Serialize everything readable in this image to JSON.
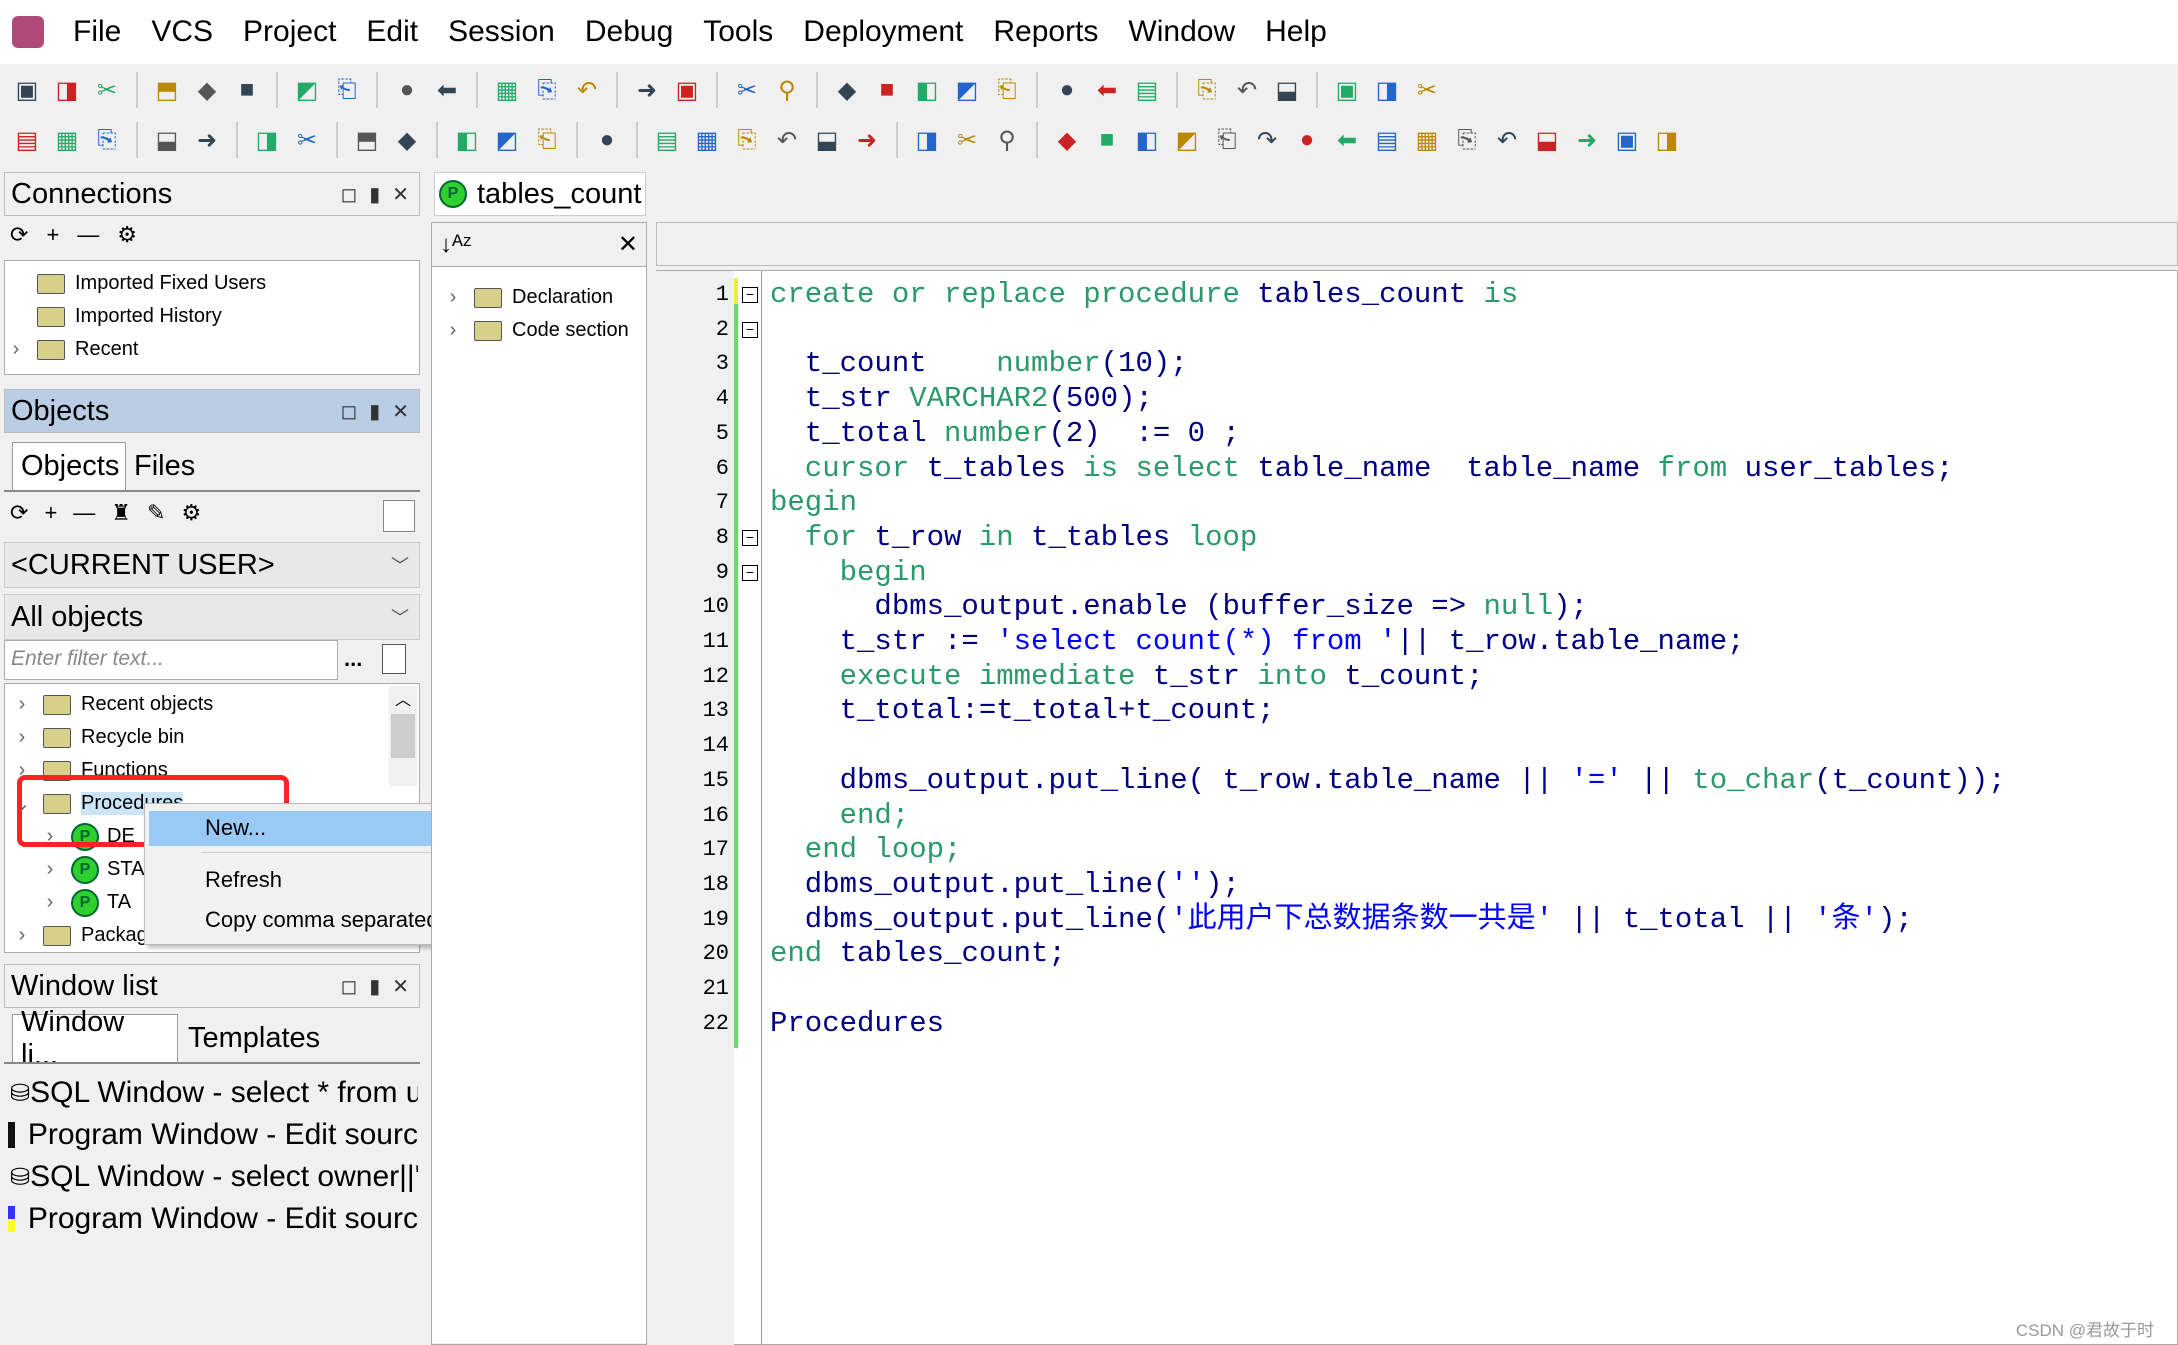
{
  "menu": [
    "File",
    "VCS",
    "Project",
    "Edit",
    "Session",
    "Debug",
    "Tools",
    "Deployment",
    "Reports",
    "Window",
    "Help"
  ],
  "toolbar1": [
    "new-icon",
    "open-icon",
    "print-setup-icon",
    "sep",
    "save-icon",
    "save-as-icon",
    "save-all-icon",
    "sep",
    "print-icon",
    "print-preview-icon",
    "sep",
    "undo-icon",
    "redo-icon",
    "sep",
    "cut-icon",
    "copy-icon",
    "paste-icon",
    "sep",
    "find-icon",
    "replace-icon",
    "sep",
    "import-icon",
    "export-icon",
    "sep",
    "indent-icon",
    "unindent-icon",
    "align-icon",
    "pdf-icon",
    "doc-icon",
    "sep",
    "window-icon",
    "window2-icon",
    "window3-icon",
    "sep",
    "cascade-icon",
    "tile-icon",
    "split-icon",
    "sep",
    "oracle-icon",
    "pdf-export-icon",
    "info-icon"
  ],
  "toolbar2": [
    "connect-icon",
    "compile-icon",
    "run-icon",
    "sep",
    "commit-icon",
    "rollback-icon",
    "sep",
    "db-icon",
    "sql-icon",
    "sep",
    "schema-icon",
    "refresh-icon",
    "sep",
    "explain-icon",
    "statistics-icon",
    "report-icon",
    "sep",
    "tools-icon",
    "sep",
    "breakpoint-icon",
    "eraser-icon",
    "stop-icon",
    "debug-icon",
    "trace-icon",
    "step-icon",
    "sep",
    "forward-icon",
    "back-icon",
    "exit-icon",
    "sep",
    "step-into-icon",
    "step-over-icon",
    "step-out-icon",
    "run-to-icon",
    "pause-icon",
    "watch-icon",
    "move-icon",
    "down-icon",
    "up-icon",
    "left-icon",
    "right-icon",
    "share-icon",
    "mail-icon",
    "next-icon",
    "last-icon",
    "unlock-icon"
  ],
  "connections": {
    "title": "Connections",
    "items": [
      "Imported Fixed Users",
      "Imported History",
      "Recent"
    ]
  },
  "objects": {
    "title": "Objects",
    "tabs": [
      "Objects",
      "Files"
    ],
    "user": "<CURRENT USER>",
    "filter_type": "All objects",
    "filter_placeholder": "Enter filter text...",
    "filter_btn": "...",
    "tree": [
      {
        "label": "Recent objects",
        "type": "folder"
      },
      {
        "label": "Recycle bin",
        "type": "folder"
      },
      {
        "label": "Functions",
        "type": "folder"
      },
      {
        "label": "Procedures",
        "type": "folder-open"
      },
      {
        "label": "DE",
        "type": "proc"
      },
      {
        "label": "STA",
        "type": "proc"
      },
      {
        "label": "TA",
        "type": "proc"
      },
      {
        "label": "Packag",
        "type": "folder"
      }
    ]
  },
  "context_menu": {
    "items": [
      "New...",
      "Refresh",
      "Copy comma separated"
    ]
  },
  "window_list": {
    "title": "Window list",
    "tabs": [
      "Window li...",
      "Templates"
    ],
    "items": [
      {
        "label": "SQL Window - select * from u",
        "kind": "sql"
      },
      {
        "label": "Program Window - Edit sourc",
        "kind": "program"
      },
      {
        "label": "SQL Window - select owner||'",
        "kind": "sql"
      },
      {
        "label": "Program Window - Edit sourc",
        "kind": "program-active"
      }
    ]
  },
  "editor": {
    "tab": "tables_count",
    "outline": [
      "Declaration",
      "Code section"
    ],
    "lines": [
      [
        [
          "create or replace procedure ",
          "kw"
        ],
        [
          "tables_count ",
          "id"
        ],
        [
          "is",
          "kw"
        ]
      ],
      [],
      [
        [
          "  t_count    ",
          "id"
        ],
        [
          "number",
          "kw"
        ],
        [
          "(10);",
          "pl"
        ]
      ],
      [
        [
          "  t_str ",
          "id"
        ],
        [
          "VARCHAR2",
          "kw"
        ],
        [
          "(500);",
          "pl"
        ]
      ],
      [
        [
          "  t_total ",
          "id"
        ],
        [
          "number",
          "kw"
        ],
        [
          "(2)  := 0 ;",
          "pl"
        ]
      ],
      [
        [
          "  cursor ",
          "kw"
        ],
        [
          "t_tables ",
          "id"
        ],
        [
          "is select ",
          "kw"
        ],
        [
          "table_name  table_name ",
          "id"
        ],
        [
          "from ",
          "kw"
        ],
        [
          "user_tables;",
          "id"
        ]
      ],
      [
        [
          "begin",
          "kw"
        ]
      ],
      [
        [
          "  for ",
          "kw"
        ],
        [
          "t_row ",
          "id"
        ],
        [
          "in ",
          "kw"
        ],
        [
          "t_tables ",
          "id"
        ],
        [
          "loop",
          "kw"
        ]
      ],
      [
        [
          "    begin",
          "kw"
        ]
      ],
      [
        [
          "      dbms_output.enable (buffer_size => ",
          "id"
        ],
        [
          "null",
          "kw"
        ],
        [
          ");",
          "pl"
        ]
      ],
      [
        [
          "    t_str := ",
          "id"
        ],
        [
          "'select count(*) from '",
          "str"
        ],
        [
          "|| t_row.table_name;",
          "id"
        ]
      ],
      [
        [
          "    execute immediate ",
          "kw"
        ],
        [
          "t_str ",
          "id"
        ],
        [
          "into ",
          "kw"
        ],
        [
          "t_count;",
          "id"
        ]
      ],
      [
        [
          "    t_total:=t_total+t_count;",
          "id"
        ]
      ],
      [],
      [
        [
          "    dbms_output.put_line( t_row.table_name || ",
          "id"
        ],
        [
          "'='",
          "str"
        ],
        [
          " || ",
          "id"
        ],
        [
          "to_char",
          "kw"
        ],
        [
          "(t_count));",
          "id"
        ]
      ],
      [
        [
          "    end;",
          "kw"
        ]
      ],
      [
        [
          "  end loop;",
          "kw"
        ]
      ],
      [
        [
          "  dbms_output.put_line(",
          "id"
        ],
        [
          "''",
          "str"
        ],
        [
          ");",
          "id"
        ]
      ],
      [
        [
          "  dbms_output.put_line(",
          "id"
        ],
        [
          "'此用户下总数据条数一共是'",
          "str"
        ],
        [
          " || t_total || ",
          "id"
        ],
        [
          "'条'",
          "str"
        ],
        [
          ");",
          "id"
        ]
      ],
      [
        [
          "end ",
          "kw"
        ],
        [
          "tables_count;",
          "id"
        ]
      ],
      [],
      [
        [
          "Procedures",
          "id"
        ]
      ]
    ]
  },
  "watermark": "CSDN @君故于时"
}
